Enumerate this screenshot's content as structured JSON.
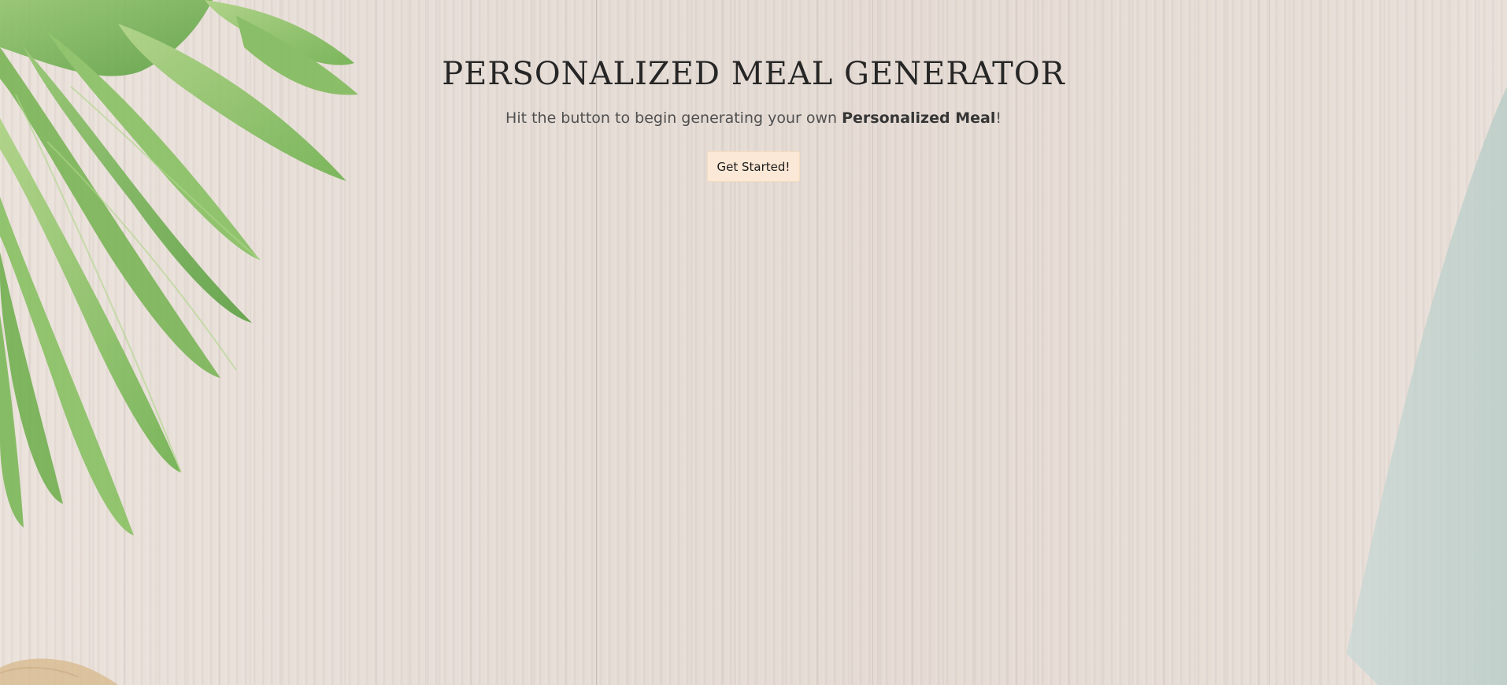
{
  "hero": {
    "title": "PERSONALIZED MEAL GENERATOR",
    "subtitle_prefix": "Hit the button to begin generating your own ",
    "subtitle_bold": "Personalized Meal",
    "subtitle_suffix": "!",
    "cta_label": "Get Started!"
  },
  "theme": {
    "button_bg": "#fbe8d6",
    "background": "#e6dcd4",
    "title_color": "#262626"
  }
}
